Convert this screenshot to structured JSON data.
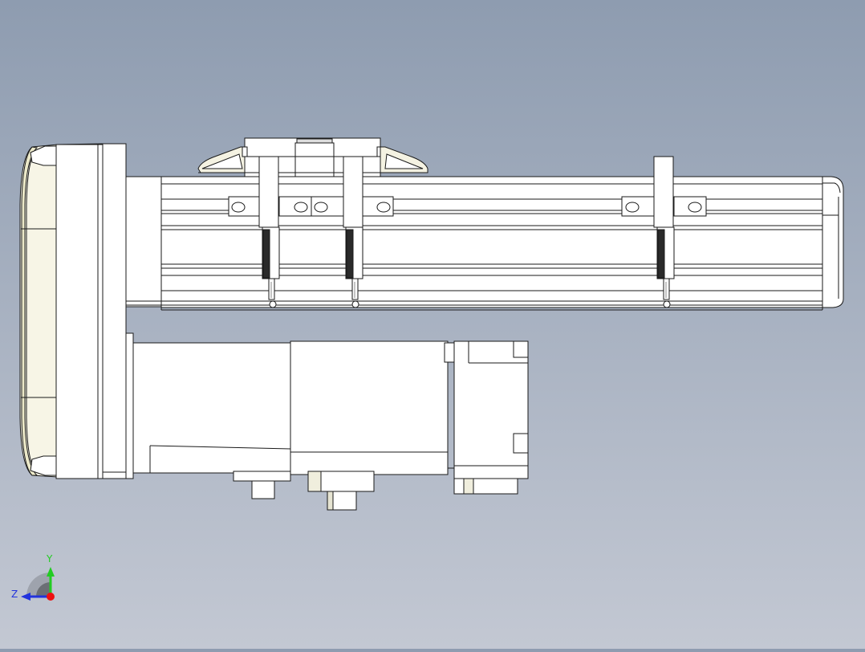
{
  "viewport": {
    "background_top": "#8e9cb0",
    "background_bottom": "#c3c8d3"
  },
  "model": {
    "face_color": "#ffffff",
    "edge_color": "#1a1a1a",
    "cover_shade": "#ece9c9",
    "sensor_body_color": "#2a2a2a",
    "parts": [
      "end-cover",
      "actuator-rail",
      "carriage",
      "limit-sensor-1",
      "limit-sensor-2",
      "limit-sensor-3",
      "motor-adapter",
      "motor-body",
      "motor-end-cap",
      "motor-connector-1",
      "motor-connector-2",
      "motor-connector-3"
    ]
  },
  "triad": {
    "y_label": "Y",
    "z_label": "Z",
    "y_color": "#22cc22",
    "z_color": "#2233dd",
    "x_color": "#ee1111"
  }
}
